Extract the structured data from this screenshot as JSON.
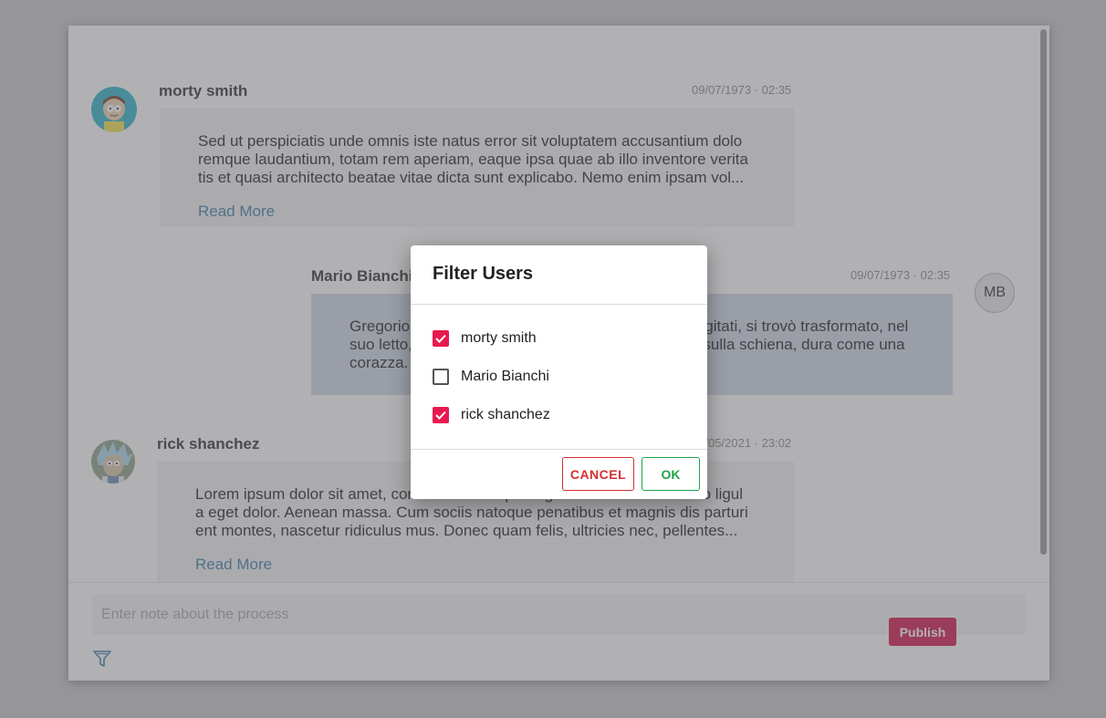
{
  "feed": {
    "posts": [
      {
        "author": "morty smith",
        "date": "09/07/1973 · 02:35",
        "text": "Sed ut perspiciatis unde omnis iste natus error sit voluptatem accusantium dolo remque laudantium, totam rem aperiam, eaque ipsa quae ab illo inventore verita tis et quasi architecto beatae vitae dicta sunt explicabo. Nemo enim ipsam vol...",
        "read_more": "Read More"
      },
      {
        "author": "Mario Bianchi",
        "avatar_initials": "MB",
        "date": "09/07/1973 · 02:35",
        "text": "Gregorio Samsa, svegliatosi una mattina da sogni agitati, si trovò trasformato, nel suo letto, in un enorme insetto immondo. Riposava sulla schiena, dura come una corazza."
      },
      {
        "author": "rick shanchez",
        "date": "01/05/2021 · 23:02",
        "text": "Lorem ipsum dolor sit amet, consectetuer adipiscing elit. Aenean commodo ligul a eget dolor. Aenean massa. Cum sociis natoque penatibus et magnis dis parturi ent montes, nascetur ridiculus mus. Donec quam felis, ultricies nec, pellentes...",
        "read_more": "Read More"
      }
    ]
  },
  "composer": {
    "placeholder": "Enter note about the process",
    "value": "",
    "publish_label": "Publish",
    "filter_icon": "filter-icon"
  },
  "dialog": {
    "title": "Filter Users",
    "options": [
      {
        "label": "morty smith",
        "checked": true
      },
      {
        "label": "Mario Bianchi",
        "checked": false
      },
      {
        "label": "rick shanchez",
        "checked": true
      }
    ],
    "cancel_label": "CANCEL",
    "ok_label": "OK"
  },
  "colors": {
    "accent": "#e8194f",
    "publish": "#d1154a",
    "cancel": "#d32f2f",
    "ok": "#22a34a",
    "link": "#3d7ea6"
  }
}
